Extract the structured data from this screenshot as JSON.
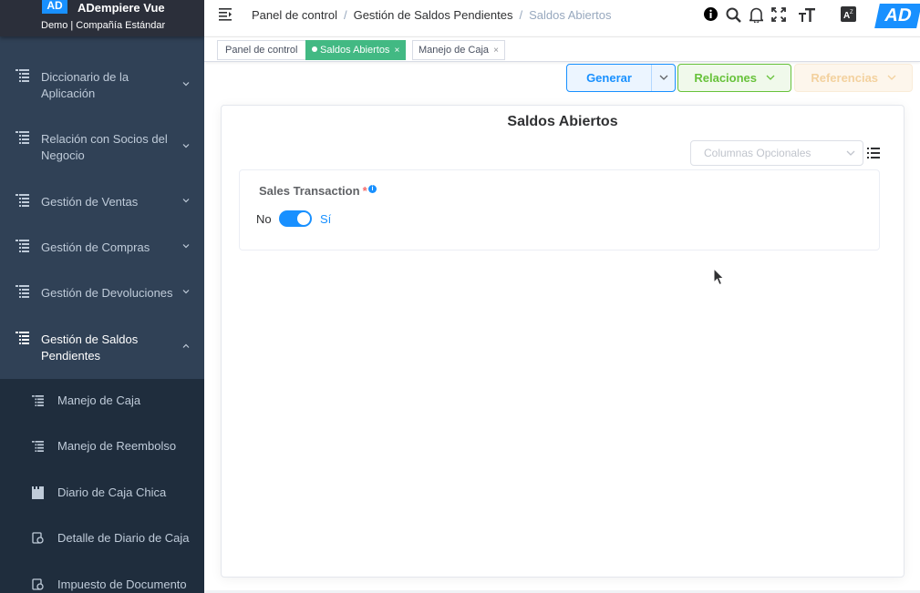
{
  "sidebar": {
    "logo_text": "AD",
    "app_title": "ADempiere Vue",
    "org_line": "Demo | Compañía Estándar",
    "menu": [
      {
        "label": "Diccionario de la Aplicación",
        "expanded": false
      },
      {
        "label": "Relación con Socios del Negocio",
        "expanded": false
      },
      {
        "label": "Gestión de Ventas",
        "expanded": false
      },
      {
        "label": "Gestión de Compras",
        "expanded": false
      },
      {
        "label": "Gestión de Devoluciones",
        "expanded": false
      },
      {
        "label": "Gestión de Saldos Pendientes",
        "expanded": true
      }
    ],
    "submenu": [
      {
        "label": "Manejo de Caja",
        "icon": "tree-list-icon"
      },
      {
        "label": "Manejo de Reembolso",
        "icon": "tree-list-icon"
      },
      {
        "label": "Diario de Caja Chica",
        "icon": "document-icon"
      },
      {
        "label": "Detalle de Diario de Caja",
        "icon": "process-icon"
      },
      {
        "label": "Impuesto de Documento",
        "icon": "process-icon"
      }
    ]
  },
  "navbar": {
    "breadcrumb": [
      "Panel de control",
      "Gestión de Saldos Pendientes",
      "Saldos Abiertos"
    ],
    "separator": "/",
    "logo_text": "AD",
    "icons": [
      "info-icon",
      "search-icon",
      "bell-icon",
      "fullscreen-icon",
      "text-size-icon",
      "language-icon"
    ]
  },
  "tags": [
    {
      "label": "Panel de control",
      "active": false,
      "closable": false
    },
    {
      "label": "Saldos Abiertos",
      "active": true,
      "closable": true
    },
    {
      "label": "Manejo de Caja",
      "active": false,
      "closable": true
    }
  ],
  "tag_close": "×",
  "actions": {
    "generate": "Generar",
    "relations": "Relaciones",
    "references": "Referencias"
  },
  "panel": {
    "title": "Saldos Abiertos",
    "optional_columns_placeholder": "Columnas Opcionales",
    "field": {
      "label": "Sales Transaction",
      "required_mark": "*",
      "info_mark": "i",
      "off_label": "No",
      "on_label": "Sí",
      "value": true
    }
  },
  "colors": {
    "sidebar_bg": "#304156",
    "submenu_bg": "#1f2d3d",
    "primary": "#1890ff",
    "success": "#67c23a",
    "warning_light": "#f3d19e",
    "active_tag": "#42b983"
  }
}
